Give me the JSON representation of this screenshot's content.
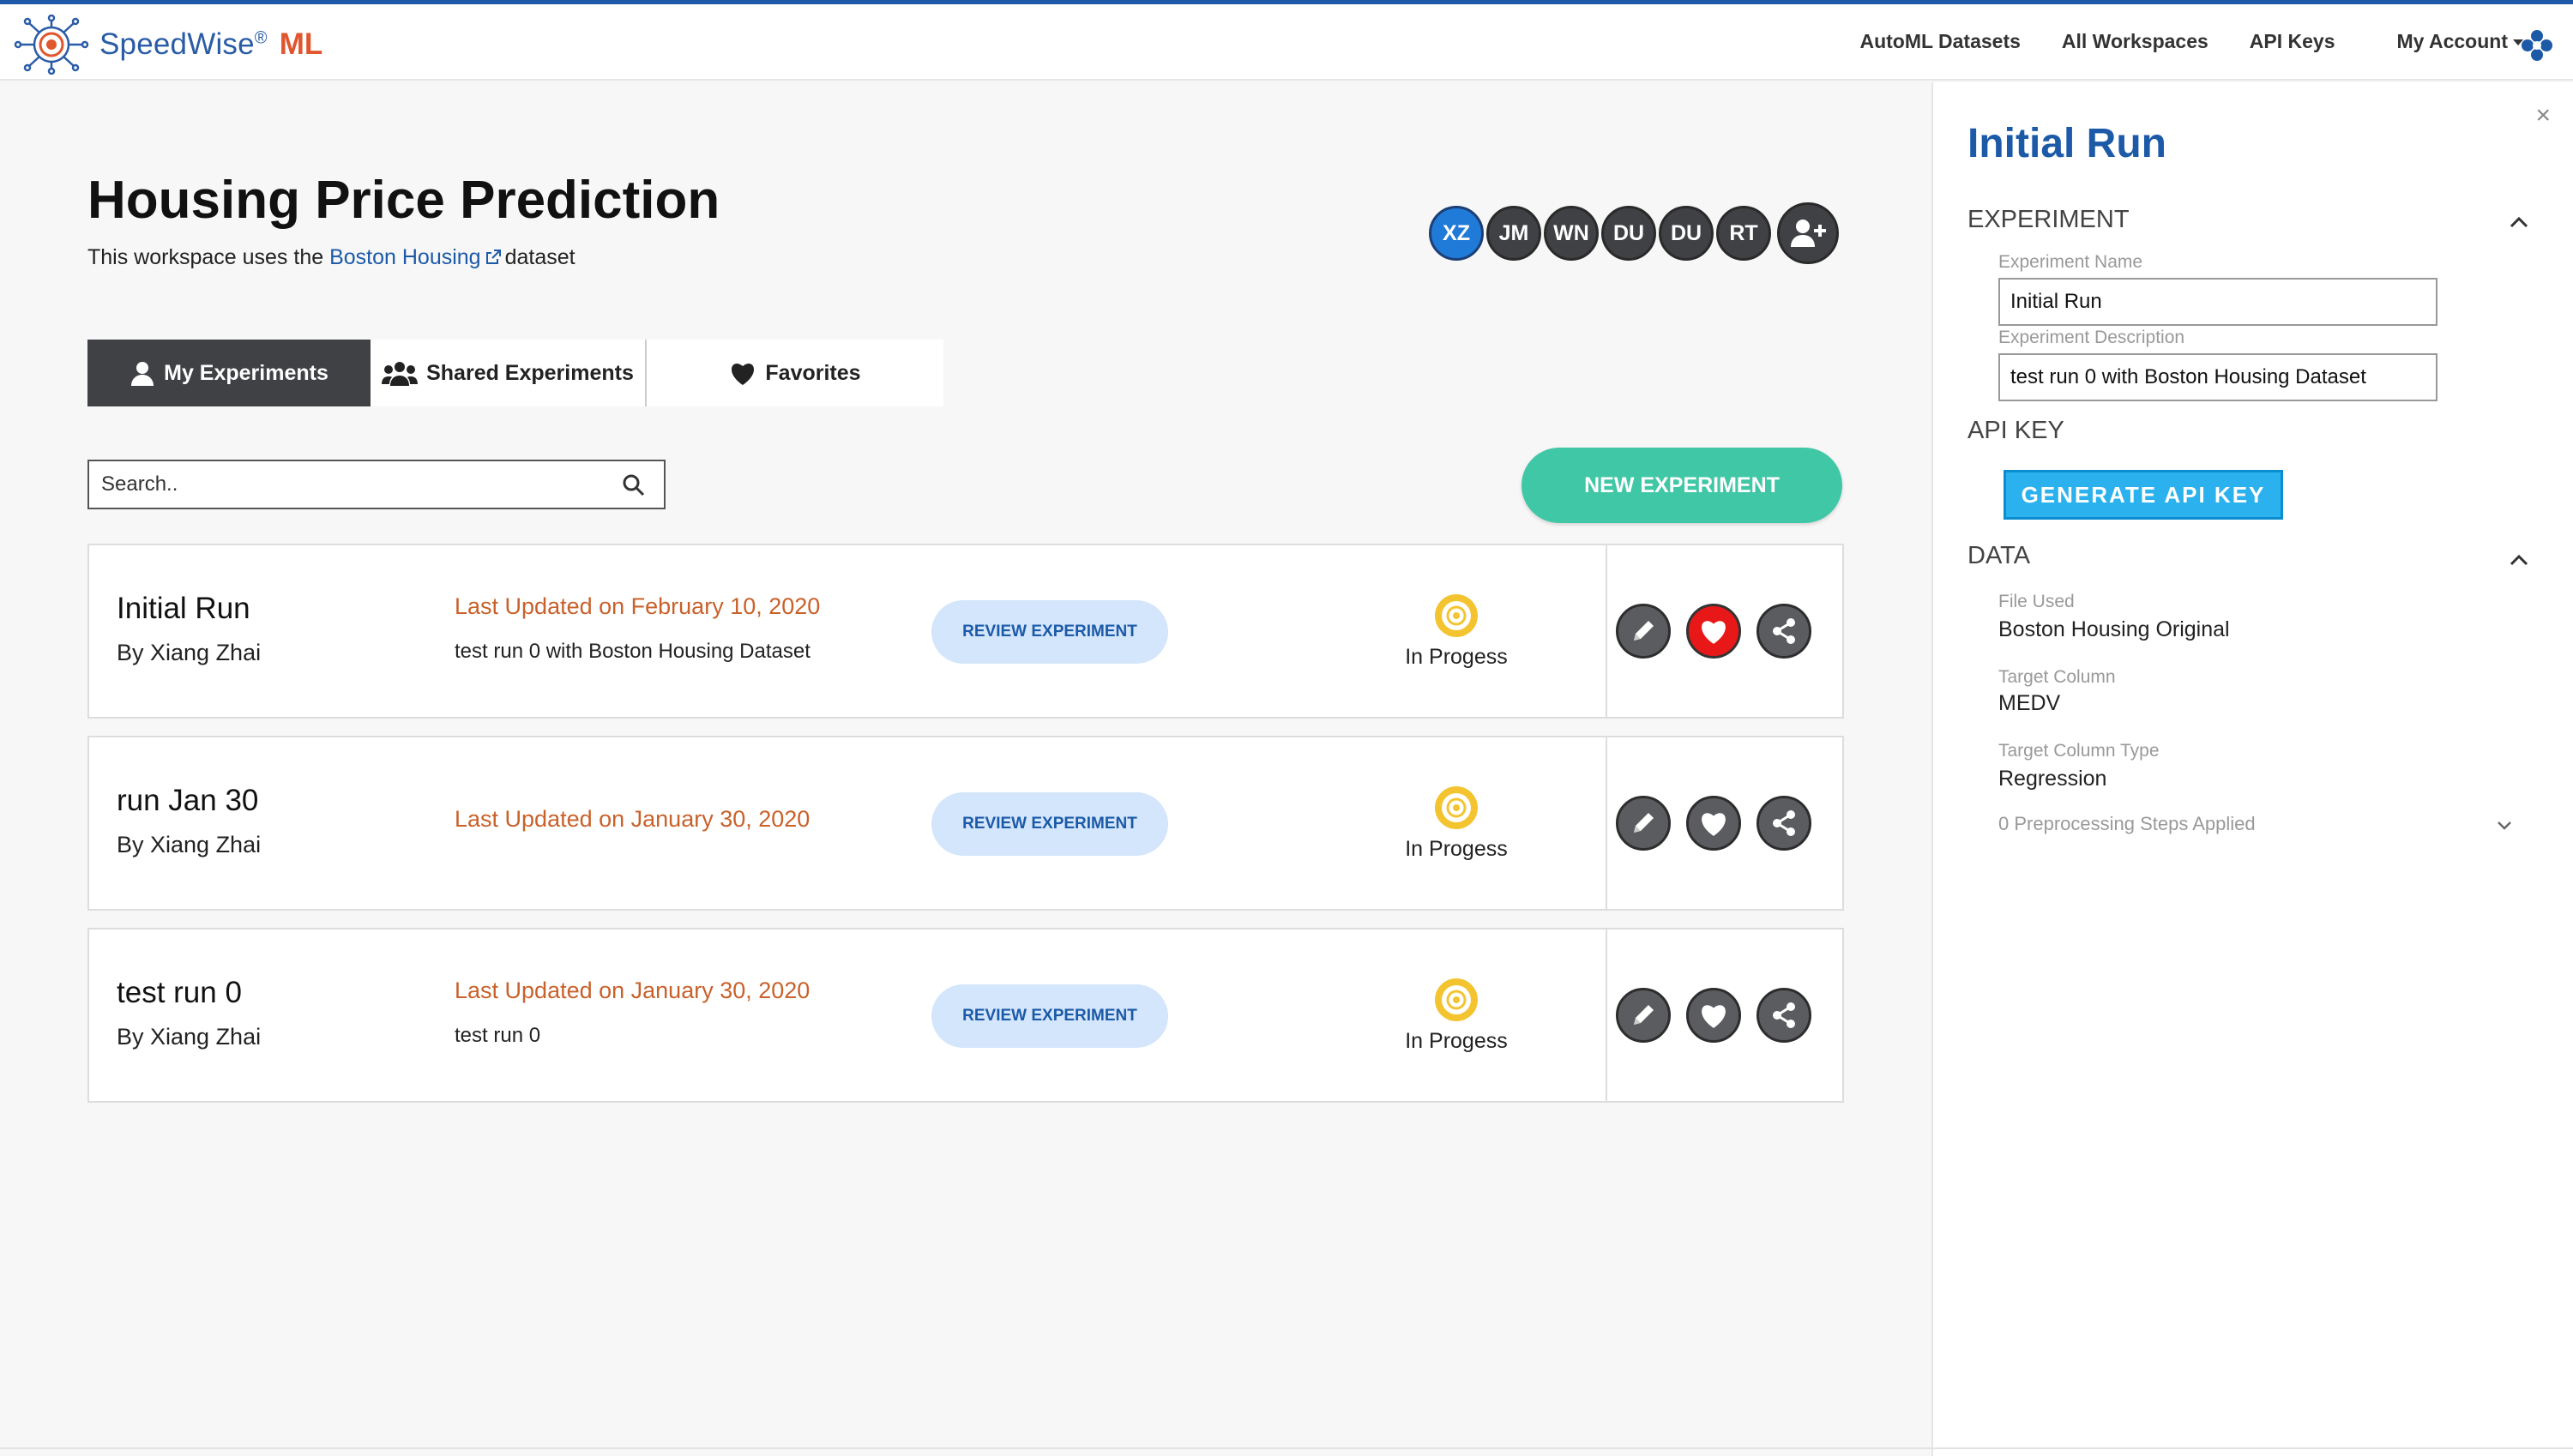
{
  "brand": {
    "name": "SpeedWise",
    "reg": "®",
    "ml": "ML"
  },
  "nav": {
    "items": [
      "AutoML Datasets",
      "All Workspaces",
      "API Keys"
    ],
    "account": "My Account"
  },
  "workspace": {
    "title": "Housing Price Prediction",
    "subtitle_pre": "This workspace uses the",
    "dataset_link": "Boston Housing",
    "subtitle_post": "dataset"
  },
  "avatars": [
    "XZ",
    "JM",
    "WN",
    "DU",
    "DU",
    "RT"
  ],
  "tabs": {
    "my": "My Experiments",
    "shared": "Shared Experiments",
    "favorites": "Favorites"
  },
  "search": {
    "placeholder": "Search.."
  },
  "new_experiment": "NEW EXPERIMENT",
  "experiments": [
    {
      "name": "Initial Run",
      "by": "By Xiang Zhai",
      "updated": "Last Updated on February 10, 2020",
      "desc": "test run 0 with Boston Housing Dataset",
      "review": "REVIEW EXPERIMENT",
      "status": "In Progess",
      "favorite": true
    },
    {
      "name": "run Jan 30",
      "by": "By Xiang Zhai",
      "updated": "Last Updated on January 30, 2020",
      "desc": "",
      "review": "REVIEW EXPERIMENT",
      "status": "In Progess",
      "favorite": false
    },
    {
      "name": "test run 0",
      "by": "By Xiang Zhai",
      "updated": "Last Updated on January 30, 2020",
      "desc": "test run 0",
      "review": "REVIEW EXPERIMENT",
      "status": "In Progess",
      "favorite": false
    }
  ],
  "panel": {
    "title": "Initial Run",
    "close": "×",
    "experiment_section": "EXPERIMENT",
    "name_label": "Experiment Name",
    "name_value": "Initial Run",
    "desc_label": "Experiment Description",
    "desc_value": "test run 0 with Boston Housing Dataset",
    "api_section": "API KEY",
    "api_button": "GENERATE API KEY",
    "data_section": "DATA",
    "file_label": "File Used",
    "file_value": "Boston Housing Original",
    "target_label": "Target Column",
    "target_value": "MEDV",
    "type_label": "Target Column Type",
    "type_value": "Regression",
    "preprocessing": "0 Preprocessing Steps Applied"
  },
  "colors": {
    "accent": "#1c5aa8",
    "brand_ml": "#e0562e",
    "new_btn": "#40c7a6",
    "updated": "#c8612a",
    "fav_on": "#e81818"
  }
}
